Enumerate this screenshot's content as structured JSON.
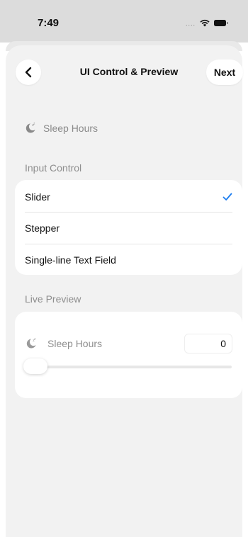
{
  "status_bar": {
    "time": "7:49",
    "signal_dots": "...."
  },
  "nav": {
    "back_icon": "chevron-left-icon",
    "title": "UI Control & Preview",
    "next_label": "Next"
  },
  "header": {
    "icon": "moon-zzz-icon",
    "label": "Sleep Hours"
  },
  "input_control": {
    "section_label": "Input Control",
    "options": [
      {
        "label": "Slider",
        "selected": true
      },
      {
        "label": "Stepper",
        "selected": false
      },
      {
        "label": "Single-line Text Field",
        "selected": false
      }
    ],
    "accent": "#1a7cf0"
  },
  "live_preview": {
    "section_label": "Live Preview",
    "label": "Sleep Hours",
    "value": "0",
    "slider_fraction": 0.0
  }
}
